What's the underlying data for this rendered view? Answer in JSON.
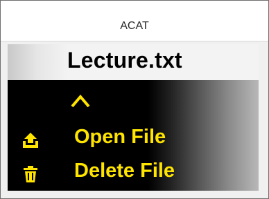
{
  "window": {
    "title": "ACAT"
  },
  "header": {
    "filename": "Lecture.txt"
  },
  "menu": {
    "items": [
      {
        "label": "Open File",
        "icon": "upload-icon"
      },
      {
        "label": "Delete File",
        "icon": "trash-icon"
      }
    ],
    "scroll_icon": "chevron-up-icon"
  },
  "colors": {
    "panel_background": "#000000",
    "accent_yellow": "#ffe400",
    "header_background": "#f3f3f3"
  }
}
